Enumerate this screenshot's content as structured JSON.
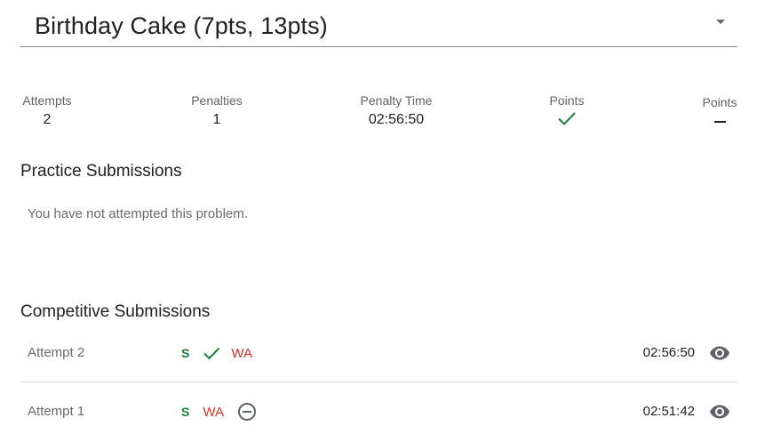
{
  "problem": {
    "title": "Birthday Cake (7pts, 13pts)"
  },
  "stats": {
    "attempts_label": "Attempts",
    "attempts_value": "2",
    "penalties_label": "Penalties",
    "penalties_value": "1",
    "penalty_time_label": "Penalty Time",
    "penalty_time_value": "02:56:50",
    "points_1_label": "Points",
    "points_1_icon": "check-icon",
    "points_2_label": "Points",
    "points_2_value": "—"
  },
  "practice": {
    "heading": "Practice Submissions",
    "empty_message": "You have not attempted this problem."
  },
  "competitive": {
    "heading": "Competitive Submissions",
    "attempts": [
      {
        "label": "Attempt 2",
        "verdicts": [
          "S",
          "check-icon",
          "WA"
        ],
        "time": "02:56:50",
        "action_icon": "eye-icon"
      },
      {
        "label": "Attempt 1",
        "verdicts": [
          "S",
          "WA",
          "block-icon"
        ],
        "time": "02:51:42",
        "action_icon": "eye-icon"
      }
    ]
  },
  "colors": {
    "correct": "#188038",
    "wrong": "#d93025",
    "icon_grey": "#5f6368"
  }
}
